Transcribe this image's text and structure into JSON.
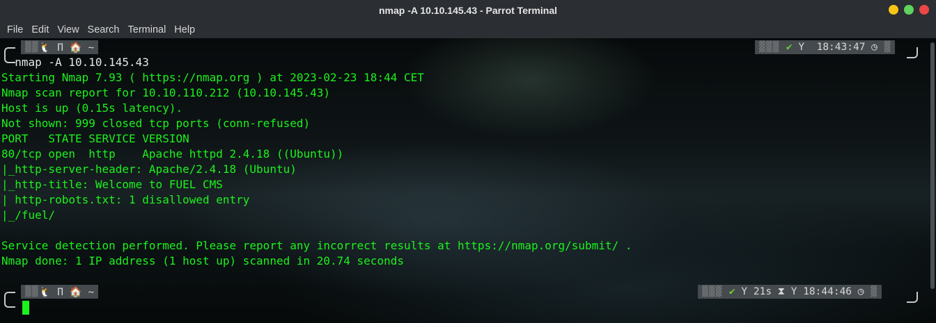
{
  "window": {
    "title": "nmap -A 10.10.145.43 - Parrot Terminal"
  },
  "menu": [
    "File",
    "Edit",
    "View",
    "Search",
    "Terminal",
    "Help"
  ],
  "prompt1": {
    "left_glyphs": "🐧 Π 🏠 ~",
    "right_check": "✔",
    "right_branch": "Y",
    "right_time": "18:43:47",
    "command": "nmap -A 10.10.145.43"
  },
  "output_lines": [
    "Starting Nmap 7.93 ( https://nmap.org ) at 2023-02-23 18:44 CET",
    "Nmap scan report for 10.10.110.212 (10.10.145.43)",
    "Host is up (0.15s latency).",
    "Not shown: 999 closed tcp ports (conn-refused)",
    "PORT   STATE SERVICE VERSION",
    "80/tcp open  http    Apache httpd 2.4.18 ((Ubuntu))",
    "|_http-server-header: Apache/2.4.18 (Ubuntu)",
    "|_http-title: Welcome to FUEL CMS",
    "| http-robots.txt: 1 disallowed entry",
    "|_/fuel/",
    "",
    "Service detection performed. Please report any incorrect results at https://nmap.org/submit/ .",
    "Nmap done: 1 IP address (1 host up) scanned in 20.74 seconds"
  ],
  "prompt2": {
    "left_glyphs": "🐧 Π 🏠 ~",
    "right_check": "✔",
    "right_branch": "Y",
    "right_duration": "21s",
    "right_hourglass": "⧗",
    "right_branch2": "Y",
    "right_time": "18:44:46"
  },
  "colors": {
    "terminal_green": "#1cf21c",
    "close": "#ec4646",
    "maximize": "#5fd35f",
    "minimize": "#f5c518"
  }
}
